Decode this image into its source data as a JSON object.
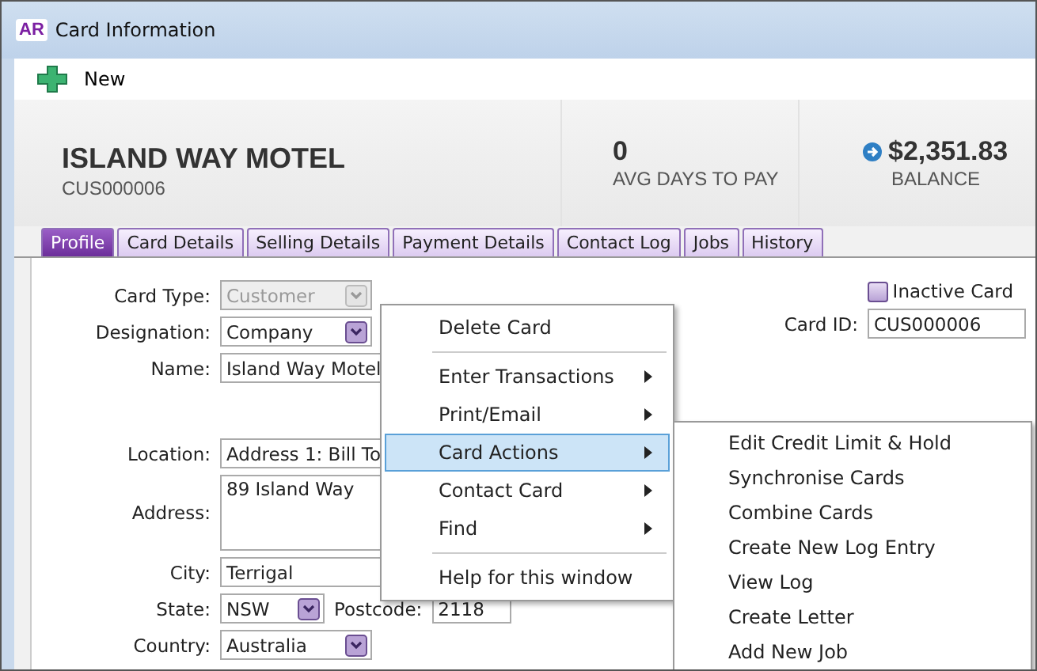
{
  "window": {
    "title": "Card Information",
    "app_badge": "AR"
  },
  "toolbar": [
    {
      "label": "New"
    }
  ],
  "header": {
    "name": "ISLAND WAY MOTEL",
    "card_id": "CUS000006",
    "stats": [
      {
        "kind": "plain",
        "value": "0",
        "label": "AVG DAYS TO PAY"
      },
      {
        "kind": "link",
        "value": "$2,351.83",
        "label": "BALANCE"
      }
    ]
  },
  "tabs": [
    {
      "label": "Profile",
      "selected": true
    },
    {
      "label": "Card Details",
      "selected": false
    },
    {
      "label": "Selling Details",
      "selected": false
    },
    {
      "label": "Payment Details",
      "selected": false
    },
    {
      "label": "Contact Log",
      "selected": false
    },
    {
      "label": "Jobs",
      "selected": false
    },
    {
      "label": "History",
      "selected": false
    }
  ],
  "form": [
    {
      "kind": "select",
      "label": "Card Type:",
      "value": "Customer",
      "disabled": true
    },
    {
      "kind": "select",
      "label": "Designation:",
      "value": "Company",
      "disabled": false
    },
    {
      "kind": "text",
      "label": "Name:",
      "value": "Island Way Motel"
    },
    {
      "kind": "gap"
    },
    {
      "kind": "text",
      "label": "Location:",
      "value": "Address 1: Bill To"
    },
    {
      "kind": "textarea",
      "label": "Address:",
      "value": "89 Island Way"
    },
    {
      "kind": "text",
      "label": "City:",
      "value": "Terrigal"
    },
    {
      "kind": "state",
      "label": "State:",
      "value": "NSW",
      "postcode_label": "Postcode:",
      "postcode": "2118"
    },
    {
      "kind": "select",
      "label": "Country:",
      "value": "Australia",
      "disabled": false
    }
  ],
  "inactive_card": {
    "label": "Inactive Card",
    "checked": false
  },
  "card_id_field": {
    "label": "Card ID:",
    "value": "CUS000006"
  },
  "context_menu": [
    {
      "kind": "item",
      "label": "Delete Card",
      "submenu": false,
      "selected": false
    },
    {
      "kind": "separator"
    },
    {
      "kind": "item",
      "label": "Enter Transactions",
      "submenu": true,
      "selected": false
    },
    {
      "kind": "item",
      "label": "Print/Email",
      "submenu": true,
      "selected": false
    },
    {
      "kind": "item",
      "label": "Card Actions",
      "submenu": true,
      "selected": true
    },
    {
      "kind": "item",
      "label": "Contact Card",
      "submenu": true,
      "selected": false
    },
    {
      "kind": "item",
      "label": "Find",
      "submenu": true,
      "selected": false
    },
    {
      "kind": "separator"
    },
    {
      "kind": "item",
      "label": "Help for this window",
      "submenu": false,
      "selected": false
    }
  ],
  "submenu": [
    "Edit Credit Limit & Hold",
    "Synchronise Cards",
    "Combine Cards",
    "Create New Log Entry",
    "View Log",
    "Create Letter",
    "Add New Job"
  ]
}
